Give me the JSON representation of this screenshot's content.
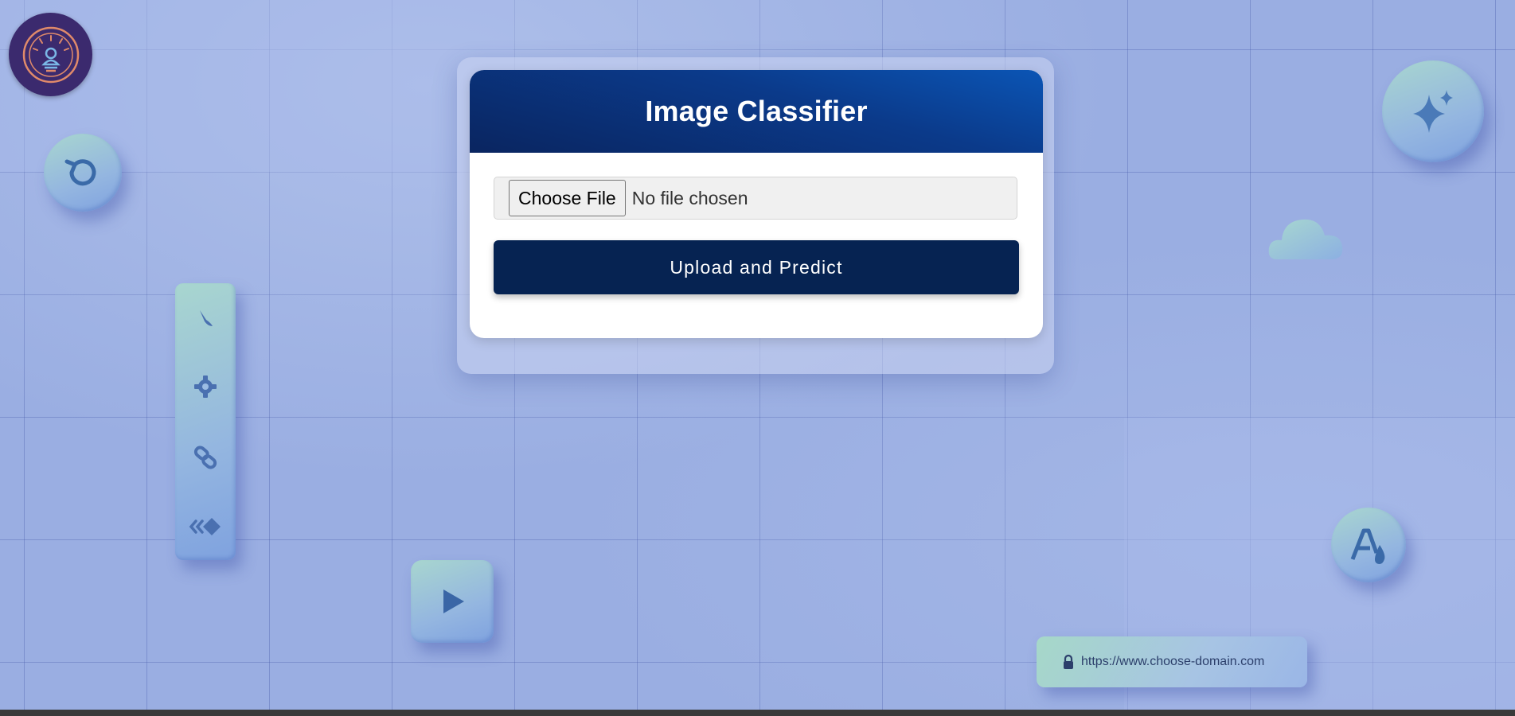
{
  "card": {
    "title": "Image Classifier",
    "file_button_label": "Choose File",
    "file_status": "No file chosen",
    "submit_label": "Upload and Predict"
  },
  "decor": {
    "url_text": "https://www.choose-domain.com",
    "icons": [
      "logo-icon",
      "refresh-icon",
      "sparkle-icon",
      "cloud-icon",
      "pen-icon",
      "gear-icon",
      "link-icon",
      "code-icon",
      "play-icon",
      "font-icon",
      "lock-icon"
    ]
  },
  "colors": {
    "header_gradient_start": "#0a2560",
    "header_gradient_end": "#0b55b5",
    "submit_button": "#062352",
    "background": "#9aaee2",
    "logo_bg": "#3b2a6e"
  }
}
